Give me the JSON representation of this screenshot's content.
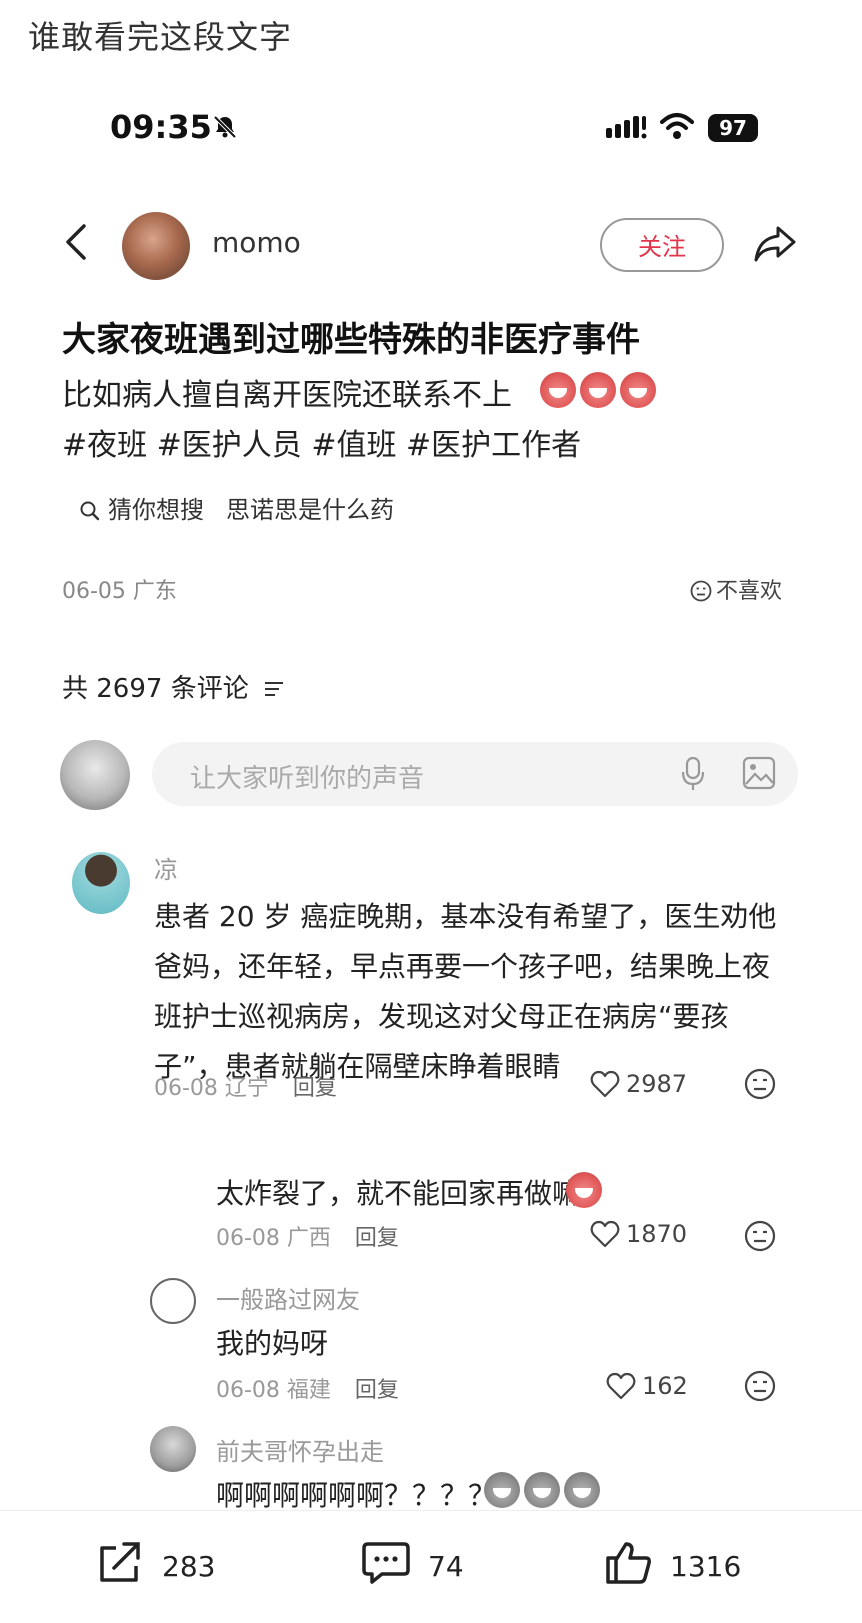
{
  "caption": "谁敢看完这段文字",
  "status_bar": {
    "time": "09:35",
    "battery": "97"
  },
  "author": {
    "name": "momo",
    "follow_label": "关注"
  },
  "post": {
    "title": "大家夜班遇到过哪些特殊的非医疗事件",
    "body": "比如病人擅自离开医院还联系不上",
    "tags": "#夜班 #医护人员 #值班 #医护工作者",
    "search_suggestion": {
      "prefix": "猜你想搜",
      "keyword": "思诺思是什么药"
    },
    "date_location": "06-05 广东",
    "dislike_label": "不喜欢"
  },
  "comments_header": {
    "count_label": "共 2697 条评论"
  },
  "comment_input": {
    "placeholder": "让大家听到你的声音"
  },
  "comments": [
    {
      "name": "凉",
      "text": "患者 20 岁 癌症晚期，基本没有希望了，医生劝他爸妈，还年轻，早点再要一个孩子吧，结果晚上夜班护士巡视病房，发现这对父母正在病房“要孩子”，患者就躺在隔壁床睁着眼睛",
      "meta": "06-08 辽宁",
      "reply_label": "回复",
      "likes": "2987"
    }
  ],
  "replies": [
    {
      "name": "",
      "text": "太炸裂了，就不能回家再做嘛",
      "meta": "06-08 广西",
      "reply_label": "回复",
      "likes": "1870"
    },
    {
      "name": "一般路过网友",
      "text": "我的妈呀",
      "meta": "06-08 福建",
      "reply_label": "回复",
      "likes": "162"
    },
    {
      "name": "前夫哥怀孕出走",
      "text": "啊啊啊啊啊啊？？？？？"
    }
  ],
  "bottom_bar": {
    "shares": "283",
    "comments": "74",
    "likes": "1316"
  },
  "colors": {
    "accent": "#e3344b",
    "text": "#222222",
    "muted": "#999999"
  }
}
